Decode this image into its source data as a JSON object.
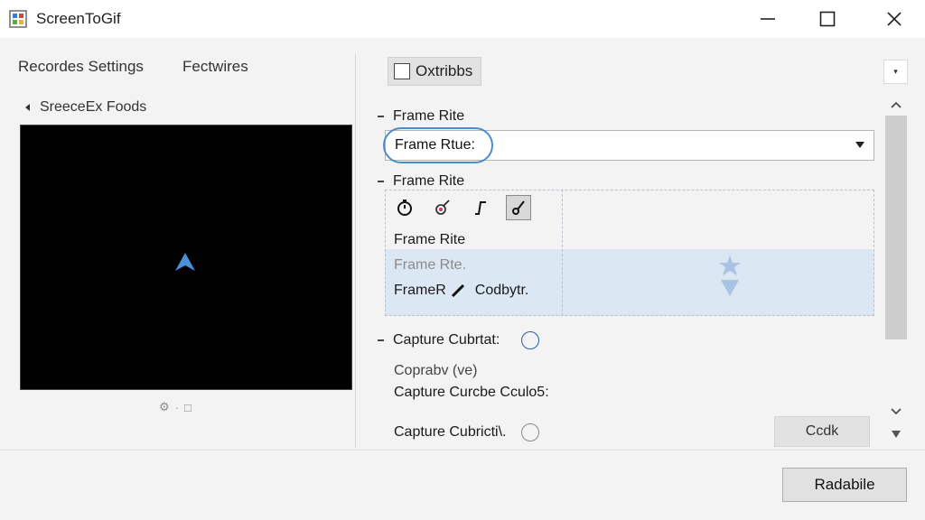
{
  "window": {
    "title": "ScreenToGif",
    "controls": {
      "minimize": "minimize-icon",
      "maximize": "maximize-icon",
      "close": "close-icon"
    }
  },
  "left": {
    "tabs": [
      "Recordes Settings",
      "Fectwires"
    ],
    "breadcrumb": "SreeceEx Foods",
    "preview_tools": [
      "⚙",
      "·",
      "□"
    ]
  },
  "options": {
    "top_checkbox": "Oxtribbs",
    "section1_title": "Frame Rite",
    "frame_select_value": "Frame Rtue:",
    "section2_title": "Frame Rite",
    "tool_icons": [
      "timer-icon",
      "color-icon",
      "curve-icon",
      "pen-icon"
    ],
    "lines": [
      "Frame Rite",
      "Frame Rte.",
      "FrameR",
      "Codbytr."
    ],
    "capture1_title": "Capture Cubrtat:",
    "capture_text1": "Coprabv (ve)",
    "capture_text2": "Capture Curcbe Cculo5:",
    "capture2_title": "Capture Cubricti\\.",
    "side_button": "Ccdk",
    "primary_button": "Radabile"
  },
  "colors": {
    "accent": "#4d8ccd",
    "highlight": "#dbe7f3",
    "preview_bg": "#000000",
    "scrollbar": "#cdcdcd"
  }
}
